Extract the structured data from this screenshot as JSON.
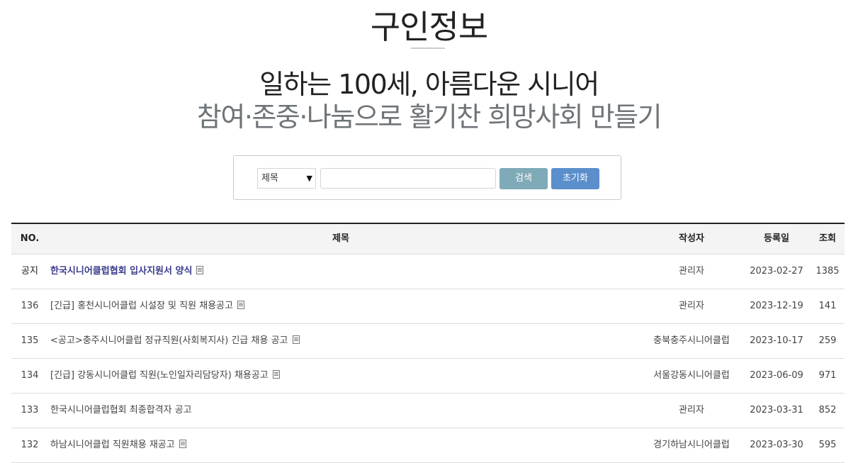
{
  "page": {
    "title": "구인정보",
    "slogan_line1": "일하는 100세, 아름다운 시니어",
    "slogan_line2": "참여·존중·나눔으로 활기찬 희망사회 만들기"
  },
  "search": {
    "select_value": "제목",
    "input_value": "",
    "search_label": "검색",
    "reset_label": "초기화"
  },
  "table": {
    "headers": {
      "no": "NO.",
      "title": "제목",
      "writer": "작성자",
      "date": "등록일",
      "views": "조회"
    },
    "rows": [
      {
        "no": "공지",
        "title": "한국시니어클럽협회 입사지원서 양식",
        "writer": "관리자",
        "date": "2023-02-27",
        "views": "1385",
        "notice": true,
        "attachment": true
      },
      {
        "no": "136",
        "title": "[긴급] 홍천시니어클럽 시설장 및 직원 채용공고",
        "writer": "관리자",
        "date": "2023-12-19",
        "views": "141",
        "attachment": true
      },
      {
        "no": "135",
        "title": "<공고>충주시니어클럽 정규직원(사회복지사) 긴급 채용 공고",
        "writer": "충북충주시니어클럽",
        "date": "2023-10-17",
        "views": "259",
        "attachment": true
      },
      {
        "no": "134",
        "title": "[긴급] 강동시니어클럽 직원(노인일자리담당자) 채용공고",
        "writer": "서울강동시니어클럽",
        "date": "2023-06-09",
        "views": "971",
        "attachment": true
      },
      {
        "no": "133",
        "title": "한국시니어클럽협회 최종합격자 공고",
        "writer": "관리자",
        "date": "2023-03-31",
        "views": "852",
        "attachment": false
      },
      {
        "no": "132",
        "title": "하남시니어클럽 직원채용 재공고",
        "writer": "경기하남시니어클럽",
        "date": "2023-03-30",
        "views": "595",
        "attachment": true
      }
    ]
  }
}
